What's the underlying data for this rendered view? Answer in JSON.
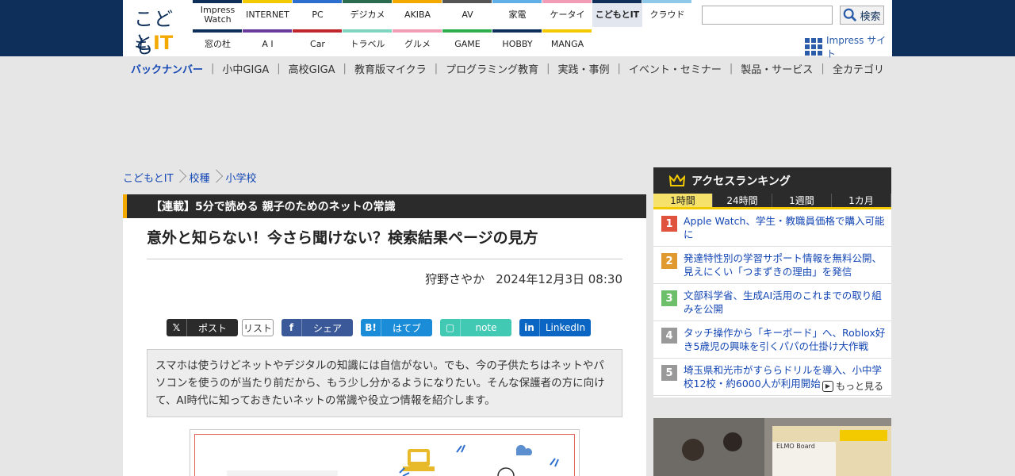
{
  "header": {
    "logo": {
      "line1": "こども",
      "line2_a": "と",
      "line2_b": "IT"
    },
    "sites_top": [
      {
        "label": "Impress Watch",
        "color": "#0e2f5a"
      },
      {
        "label": "INTERNET",
        "color": "#f3c900"
      },
      {
        "label": "PC",
        "color": "#2d6fd0"
      },
      {
        "label": "デジカメ",
        "color": "#2b6b4f"
      },
      {
        "label": "AKIBA",
        "color": "#f3a900"
      },
      {
        "label": "AV",
        "color": "#555555"
      },
      {
        "label": "家電",
        "color": "#5fb0e8"
      },
      {
        "label": "ケータイ",
        "color": "#f29cb5"
      },
      {
        "label": "こどもとIT",
        "color": "#0e2f5a"
      },
      {
        "label": "クラウド",
        "color": "#8ec9ea"
      }
    ],
    "sites_bottom": [
      {
        "label": "窓の杜",
        "color": "#0e2f5a"
      },
      {
        "label": "A I",
        "color": "#6a3a9c"
      },
      {
        "label": "Car",
        "color": "#c0262d"
      },
      {
        "label": "トラベル",
        "color": "#7fd6c0"
      },
      {
        "label": "グルメ",
        "color": "#f29cb5"
      },
      {
        "label": "GAME",
        "color": "#2fae4e"
      },
      {
        "label": "HOBBY",
        "color": "#0e2f5a"
      },
      {
        "label": "MANGA",
        "color": "#f3c900"
      }
    ],
    "search": {
      "placeholder": "",
      "button_label": "検索"
    },
    "impress_sites_label": "Impress サイト"
  },
  "nav": {
    "back_number": "バックナンバー",
    "items": [
      "小中GIGA",
      "高校GIGA",
      "教育版マイクラ",
      "プログラミング教育",
      "実践・事例",
      "イベント・セミナー",
      "製品・サービス"
    ],
    "all_categories": "全カテゴリ"
  },
  "breadcrumb": [
    "こどもとIT",
    "校種",
    "小学校"
  ],
  "article": {
    "series": "【連載】5分で読める 親子のためのネットの常識",
    "title": "意外と知らない！今さら聞けない？検索結果ページの見方",
    "author": "狩野さやか",
    "date": "2024年12月3日 08:30",
    "intro": "スマホは使うけどネットやデジタルの知識には自信がない。でも、今の子供たちはネットやパソコンを使うのが当たり前だから、もう少し分かるようになりたい。そんな保護者の方に向けて、AI時代に知っておきたいネットの常識や役立つ情報を紹介します。"
  },
  "share": {
    "x": "ポスト",
    "list": "リスト",
    "facebook": "シェア",
    "hatena": "はてブ",
    "hatena_icon": "B!",
    "note": "note",
    "linkedin": "LinkedIn"
  },
  "ranking": {
    "title": "アクセスランキング",
    "tabs": [
      "1時間",
      "24時間",
      "1週間",
      "1カ月"
    ],
    "active_tab": "1時間",
    "items": [
      {
        "rank": "1",
        "color": "#e0533f",
        "text": "Apple Watch、学生・教職員価格で購入可能に"
      },
      {
        "rank": "2",
        "color": "#e09a2f",
        "text": "発達特性別の学習サポート情報を無料公開、見えにくい「つまずきの理由」を発信"
      },
      {
        "rank": "3",
        "color": "#6dbf6a",
        "text": "文部科学省、生成AI活用のこれまでの取り組みを公開"
      },
      {
        "rank": "4",
        "color": "#999999",
        "text": "タッチ操作から「キーボード」へ、Roblox好き5歳児の興味を引くパパの仕掛け大作戦"
      },
      {
        "rank": "5",
        "color": "#999999",
        "text": "埼玉県和光市がすららドリルを導入、小中学校12校・約6000人が利用開始"
      }
    ],
    "more": "もっと見る"
  }
}
